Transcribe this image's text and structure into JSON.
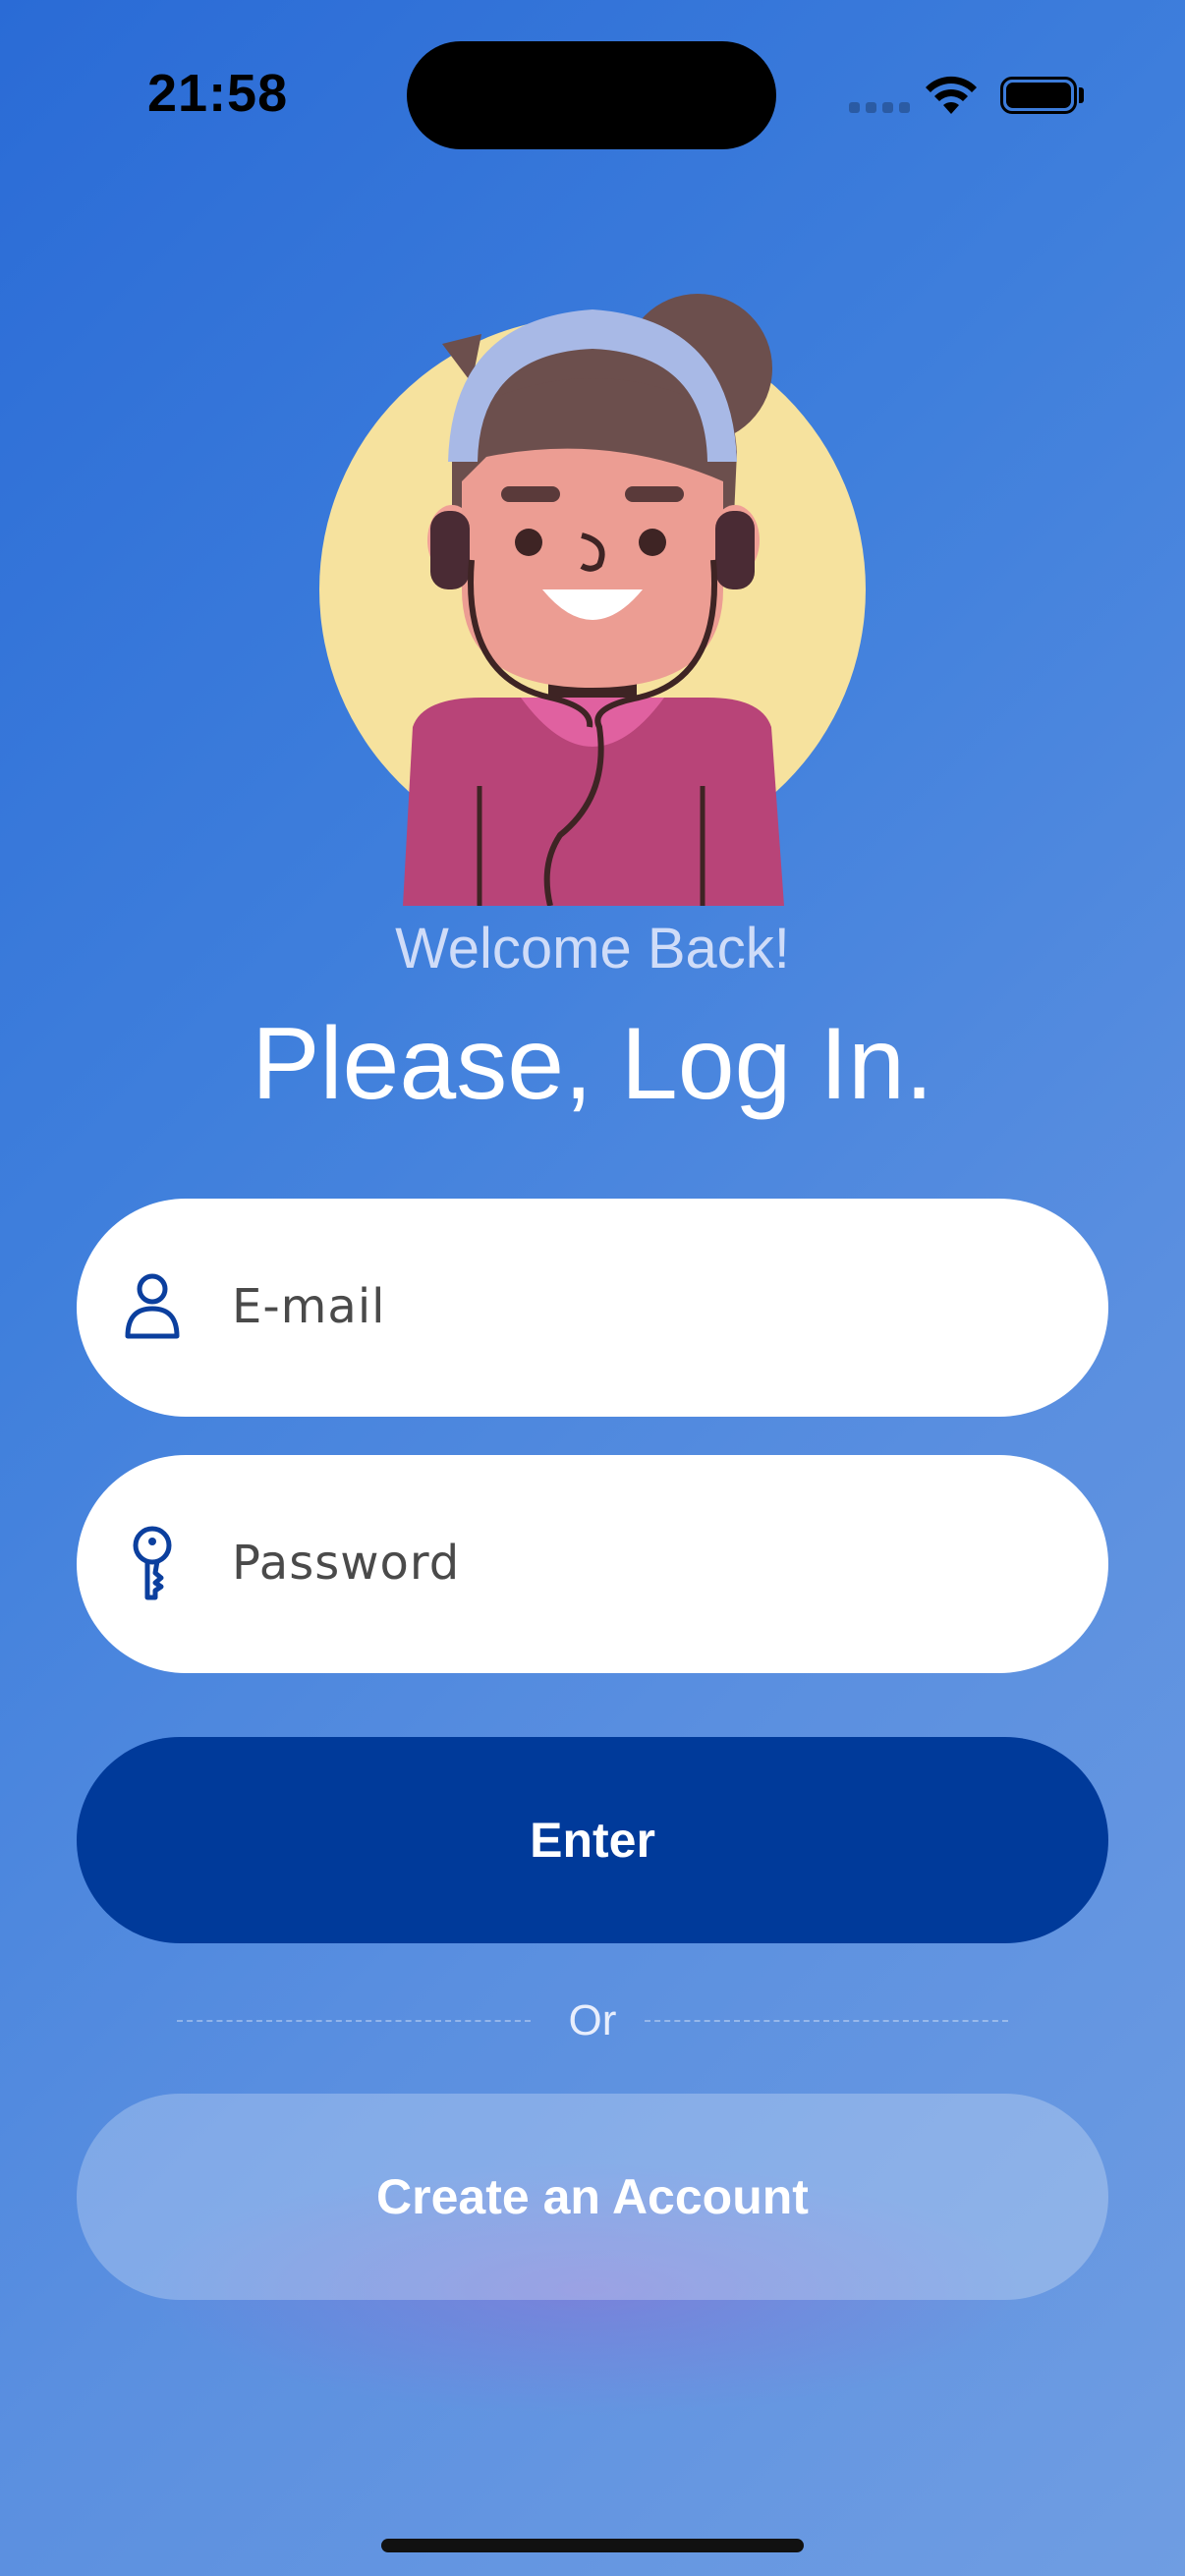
{
  "status_bar": {
    "time": "21:58",
    "icons": [
      "signal-icon",
      "wifi-icon",
      "battery-icon"
    ]
  },
  "avatar": {
    "icon": "user-avatar-illustration"
  },
  "header": {
    "subtitle": "Welcome Back!",
    "title": "Please, Log In."
  },
  "form": {
    "email": {
      "placeholder": "E-mail",
      "value": "",
      "icon": "user-icon"
    },
    "password": {
      "placeholder": "Password",
      "value": "",
      "icon": "key-icon"
    },
    "enter_label": "Enter",
    "divider_label": "Or",
    "create_account_label": "Create an Account"
  },
  "colors": {
    "background_start": "#2a6bd6",
    "background_end": "#6f9de2",
    "primary_button": "#003a9a",
    "icon_color": "#0b3f9e"
  }
}
